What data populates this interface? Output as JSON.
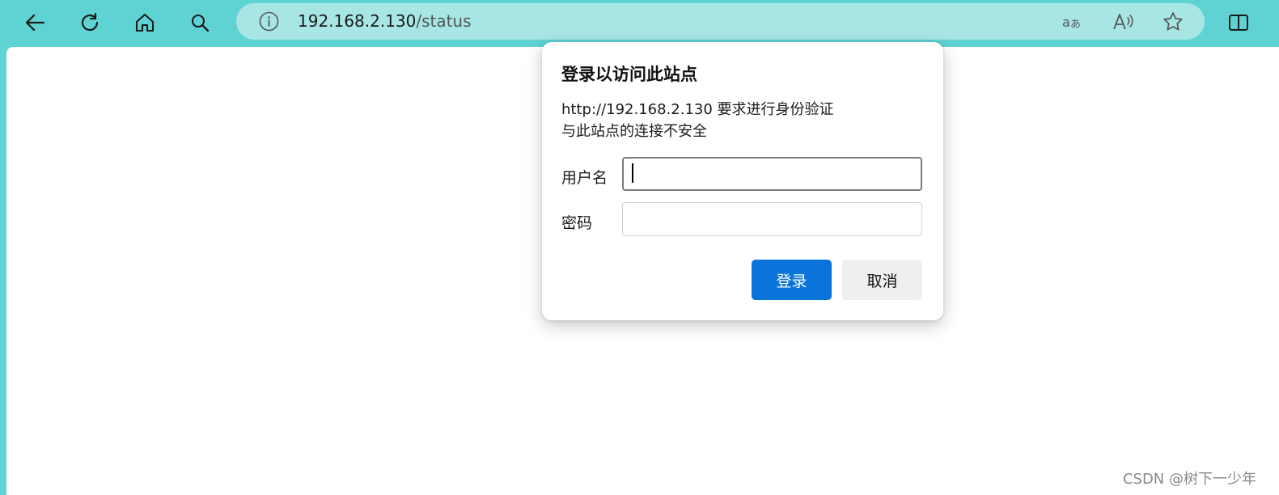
{
  "toolbar": {
    "back_icon": "back-arrow-icon",
    "refresh_icon": "refresh-icon",
    "home_icon": "home-icon",
    "search_icon": "search-icon"
  },
  "address_bar": {
    "host": "192.168.2.130",
    "path": "/status",
    "icons": [
      "info-icon",
      "translate-icon",
      "read-aloud-icon",
      "favorite-star-icon"
    ]
  },
  "split_view_icon": "split-screen-icon",
  "dialog": {
    "title": "登录以访问此站点",
    "line1": "http://192.168.2.130 要求进行身份验证",
    "line2": "与此站点的连接不安全",
    "username_label": "用户名",
    "username_value": "",
    "password_label": "密码",
    "password_value": "",
    "login_button": "登录",
    "cancel_button": "取消"
  },
  "watermark": "CSDN @树下一少年",
  "colors": {
    "chrome": "#5fd3d3",
    "address_bar": "#a8e6e6",
    "primary_button": "#0a74da",
    "secondary_button": "#efefef"
  }
}
